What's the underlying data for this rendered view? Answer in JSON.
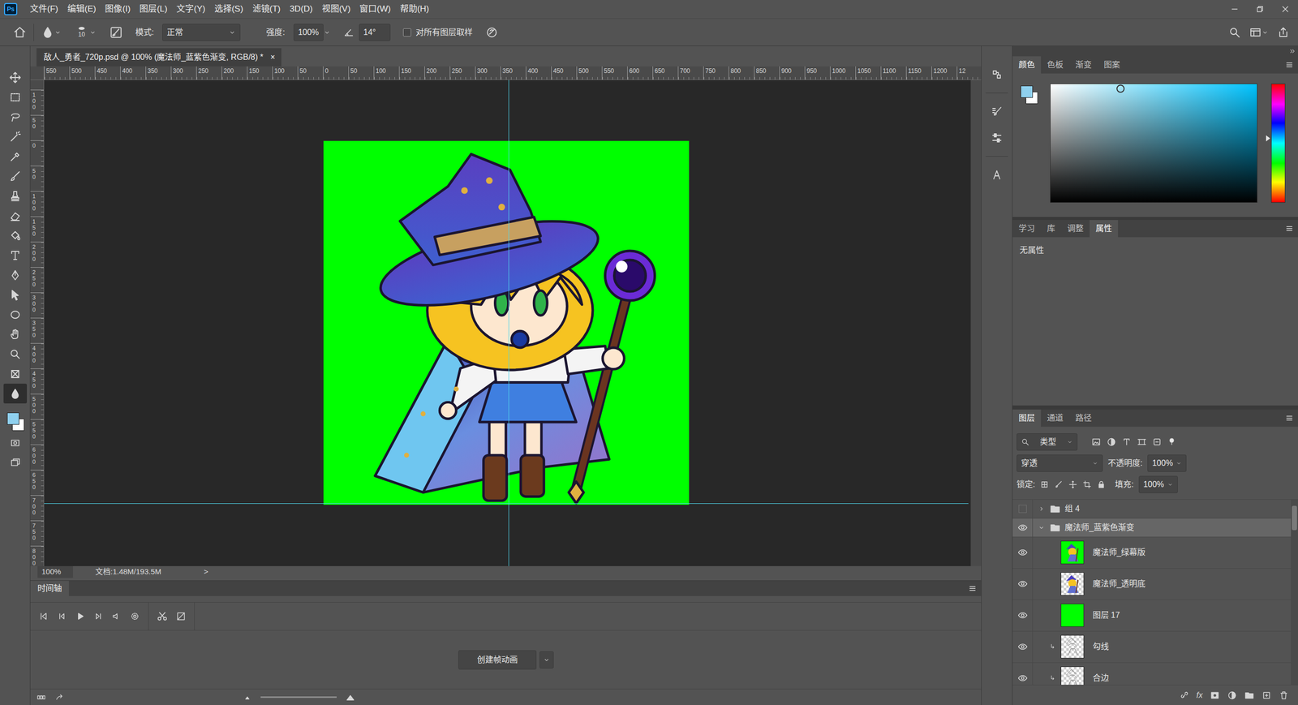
{
  "app": {
    "logo": "Ps"
  },
  "menu": [
    "文件(F)",
    "编辑(E)",
    "图像(I)",
    "图层(L)",
    "文字(Y)",
    "选择(S)",
    "滤镜(T)",
    "3D(D)",
    "视图(V)",
    "窗口(W)",
    "帮助(H)"
  ],
  "options": {
    "brush_size": "10",
    "mode_label": "模式:",
    "mode_value": "正常",
    "strength_label": "强度:",
    "strength_value": "100%",
    "angle_value": "14°",
    "sample_all": {
      "label": "对所有图层取样",
      "checked": false
    }
  },
  "document": {
    "tab_title": "敌人_勇者_720p.psd @ 100% (魔法师_蓝紫色渐变, RGB/8) *",
    "close": "×"
  },
  "rulers": {
    "top": [
      "550",
      "500",
      "450",
      "400",
      "350",
      "300",
      "250",
      "200",
      "150",
      "100",
      "50",
      "0",
      "50",
      "100",
      "150",
      "200",
      "250",
      "300",
      "350",
      "400",
      "450",
      "500",
      "550",
      "600",
      "650",
      "700",
      "750",
      "800",
      "850",
      "900",
      "950",
      "1000",
      "1050",
      "1100",
      "1150",
      "1200",
      "12"
    ],
    "left": [
      "100",
      "50",
      "0",
      "50",
      "100",
      "150",
      "200",
      "250",
      "300",
      "350",
      "400",
      "450",
      "500",
      "550",
      "600",
      "650",
      "700",
      "750",
      "800"
    ]
  },
  "toolbar": {
    "tools": [
      {
        "selected": false
      },
      {
        "selected": false
      },
      {
        "selected": false
      },
      {
        "selected": false
      },
      {
        "selected": false
      },
      {
        "selected": false
      },
      {
        "selected": false
      },
      {
        "selected": false
      },
      {
        "selected": false
      },
      {
        "selected": false
      },
      {
        "selected": false
      },
      {
        "selected": false
      },
      {
        "selected": false
      },
      {
        "selected": false
      },
      {
        "selected": false
      },
      {
        "selected": false
      },
      {
        "selected": true
      }
    ]
  },
  "status_bar": {
    "zoom": "100%",
    "doc_info": "文档:1.48M/193.5M",
    "arrow": ">"
  },
  "timeline": {
    "title": "时间轴",
    "create_button": "创建帧动画"
  },
  "color_panel": {
    "tabs": [
      {
        "label": "颜色",
        "selected": true
      },
      {
        "label": "色板",
        "selected": false
      },
      {
        "label": "渐变",
        "selected": false
      },
      {
        "label": "图案",
        "selected": false
      }
    ],
    "foreground": "#8fd0ee",
    "background": "#ffffff",
    "hue_level": 0.46,
    "picker_x": 0.34,
    "picker_y": 0.04
  },
  "properties_panel": {
    "tabs": [
      {
        "label": "学习",
        "selected": false
      },
      {
        "label": "库",
        "selected": false
      },
      {
        "label": "调整",
        "selected": false
      },
      {
        "label": "属性",
        "selected": true
      }
    ],
    "message": "无属性"
  },
  "layers_panel": {
    "tabs": [
      {
        "label": "图层",
        "selected": true
      },
      {
        "label": "通道",
        "selected": false
      },
      {
        "label": "路径",
        "selected": false
      }
    ],
    "filter_label": "类型",
    "blend_mode": "穿透",
    "opacity_label": "不透明度:",
    "opacity": "100%",
    "lock_label": "锁定:",
    "fill_label": "填充:",
    "fill": "100%",
    "fx_label": "fx",
    "layers": [
      {
        "name": "组 4",
        "kind": "group",
        "visible": false,
        "expanded": false,
        "selected": false,
        "depth": 0,
        "clipped": false,
        "thumb": "folder"
      },
      {
        "name": "魔法师_蓝紫色渐变",
        "kind": "group",
        "visible": true,
        "expanded": true,
        "selected": true,
        "depth": 0,
        "clipped": false,
        "thumb": "folder"
      },
      {
        "name": "魔法师_绿幕版",
        "kind": "layer",
        "visible": true,
        "selected": false,
        "depth": 1,
        "clipped": false,
        "thumb": "green-figure"
      },
      {
        "name": "魔法师_透明底",
        "kind": "layer",
        "visible": true,
        "selected": false,
        "depth": 1,
        "clipped": false,
        "thumb": "checker-figure"
      },
      {
        "name": "图层 17",
        "kind": "layer",
        "visible": true,
        "selected": false,
        "depth": 1,
        "clipped": false,
        "thumb": "green"
      },
      {
        "name": "勾线",
        "kind": "layer",
        "visible": true,
        "selected": false,
        "depth": 1,
        "clipped": true,
        "thumb": "checker-sketch"
      },
      {
        "name": "合边",
        "kind": "layer",
        "visible": true,
        "selected": false,
        "depth": 1,
        "clipped": true,
        "thumb": "checker-sketch"
      }
    ]
  }
}
